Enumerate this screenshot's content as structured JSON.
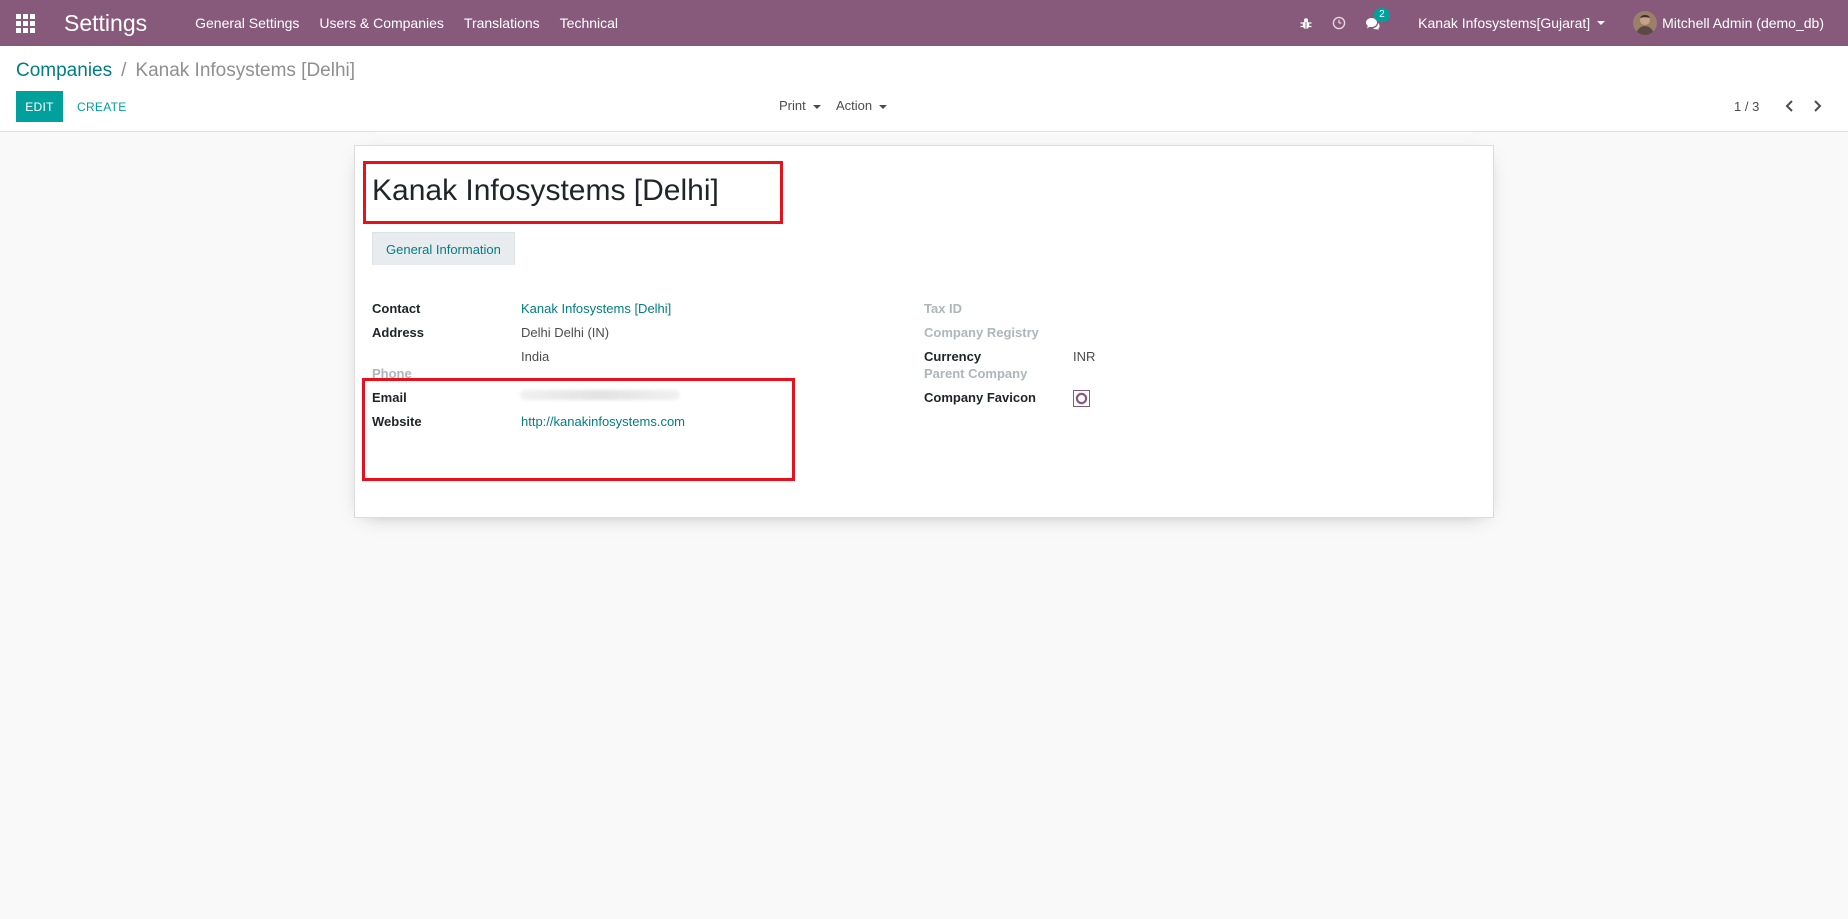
{
  "navbar": {
    "app_title": "Settings",
    "menu": [
      "General Settings",
      "Users & Companies",
      "Translations",
      "Technical"
    ],
    "messages_count": "2",
    "company": "Kanak Infosystems[Gujarat]",
    "user": "Mitchell Admin (demo_db)",
    "icons": [
      "apps-grid-icon",
      "debug-bug-icon",
      "activity-clock-icon",
      "discuss-chat-icon"
    ],
    "color": "#875a7b"
  },
  "breadcrumb": {
    "parent": "Companies",
    "separator": "/",
    "current": "Kanak Infosystems [Delhi]"
  },
  "buttons": {
    "edit": "EDIT",
    "create": "CREATE",
    "print": "Print",
    "action": "Action"
  },
  "pager": {
    "value": "1 / 3"
  },
  "form": {
    "title": "Kanak Infosystems [Delhi]",
    "tab": "General Information",
    "left": {
      "contact_label": "Contact",
      "contact_value": "Kanak Infosystems [Delhi]",
      "address_label": "Address",
      "address_line1": "Delhi  Delhi (IN)",
      "address_line2": "India",
      "phone_label": "Phone",
      "email_label": "Email",
      "website_label": "Website",
      "website_value": "http://kanakinfosystems.com"
    },
    "right": {
      "tax_id_label": "Tax ID",
      "company_registry_label": "Company Registry",
      "currency_label": "Currency",
      "currency_value": "INR",
      "parent_company_label": "Parent Company",
      "favicon_label": "Company Favicon"
    }
  },
  "colors": {
    "accent": "#00a09d",
    "link": "#017e84",
    "highlight": "#e8101a"
  }
}
